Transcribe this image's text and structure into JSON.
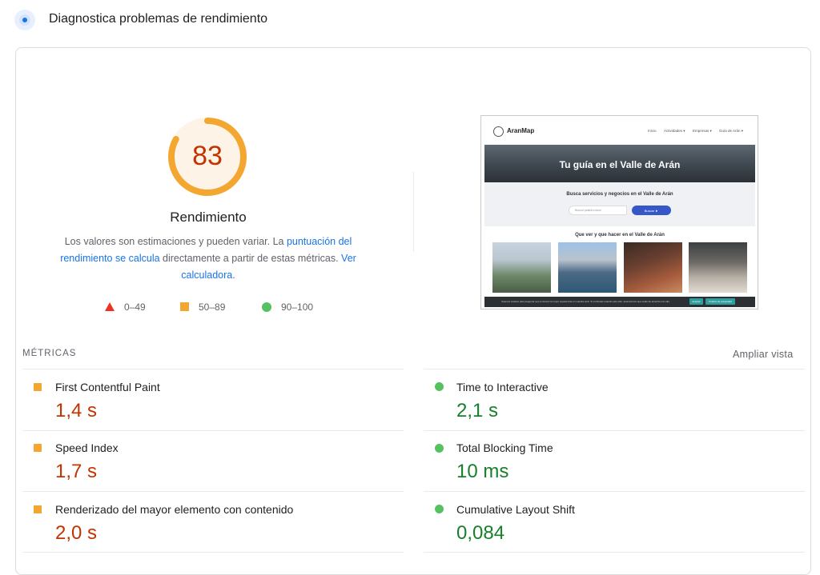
{
  "header": {
    "title": "Diagnostica problemas de rendimiento",
    "icon": "lighthouse-icon"
  },
  "score": {
    "value": "83",
    "fraction": 0.83,
    "label": "Rendimiento",
    "color": "#c33300",
    "ring_color": "#f4a730",
    "track_color": "#fdf3e6"
  },
  "description": {
    "part1": "Los valores son estimaciones y pueden variar. La ",
    "link1": "puntuación del rendimiento se calcula",
    "part2": " directamente a partir de estas métricas. ",
    "link2": "Ver calculadora",
    "part3": "."
  },
  "legend": {
    "fail": "0–49",
    "average": "50–89",
    "pass": "90–100"
  },
  "screenshot": {
    "brand": "AranMap",
    "nav": [
      "Inicio",
      "Actividades ▾",
      "Empresas ▾",
      "Guía de Arán ▾"
    ],
    "hero_title": "Tu guía en el Valle de Arán",
    "search_title": "Busca servicios y negocios en el Valle de Arán",
    "search_placeholder": "Buscar palabra clave",
    "search_button": "Buscar ►",
    "section_title": "Que ver y que hacer en el Valle de Arán",
    "cookie_text": "Usamos cookies para asegurar que te damos la mejor experiencia en nuestra web. Si continúas usando este sitio, asumiremos que estás de acuerdo con ello.",
    "cookie_accept": "Aceptar",
    "cookie_policy": "Política de privacidad"
  },
  "metrics": {
    "section_label": "MÉTRICAS",
    "expand_label": "Ampliar vista",
    "fcp": {
      "name": "First Contentful Paint",
      "value": "1,4 s",
      "status": "average"
    },
    "si": {
      "name": "Speed Index",
      "value": "1,7 s",
      "status": "average"
    },
    "lcp": {
      "name": "Renderizado del mayor elemento con contenido",
      "value": "2,0 s",
      "status": "average"
    },
    "tti": {
      "name": "Time to Interactive",
      "value": "2,1 s",
      "status": "pass"
    },
    "tbt": {
      "name": "Total Blocking Time",
      "value": "10 ms",
      "status": "pass"
    },
    "cls": {
      "name": "Cumulative Layout Shift",
      "value": "0,084",
      "status": "pass"
    }
  }
}
